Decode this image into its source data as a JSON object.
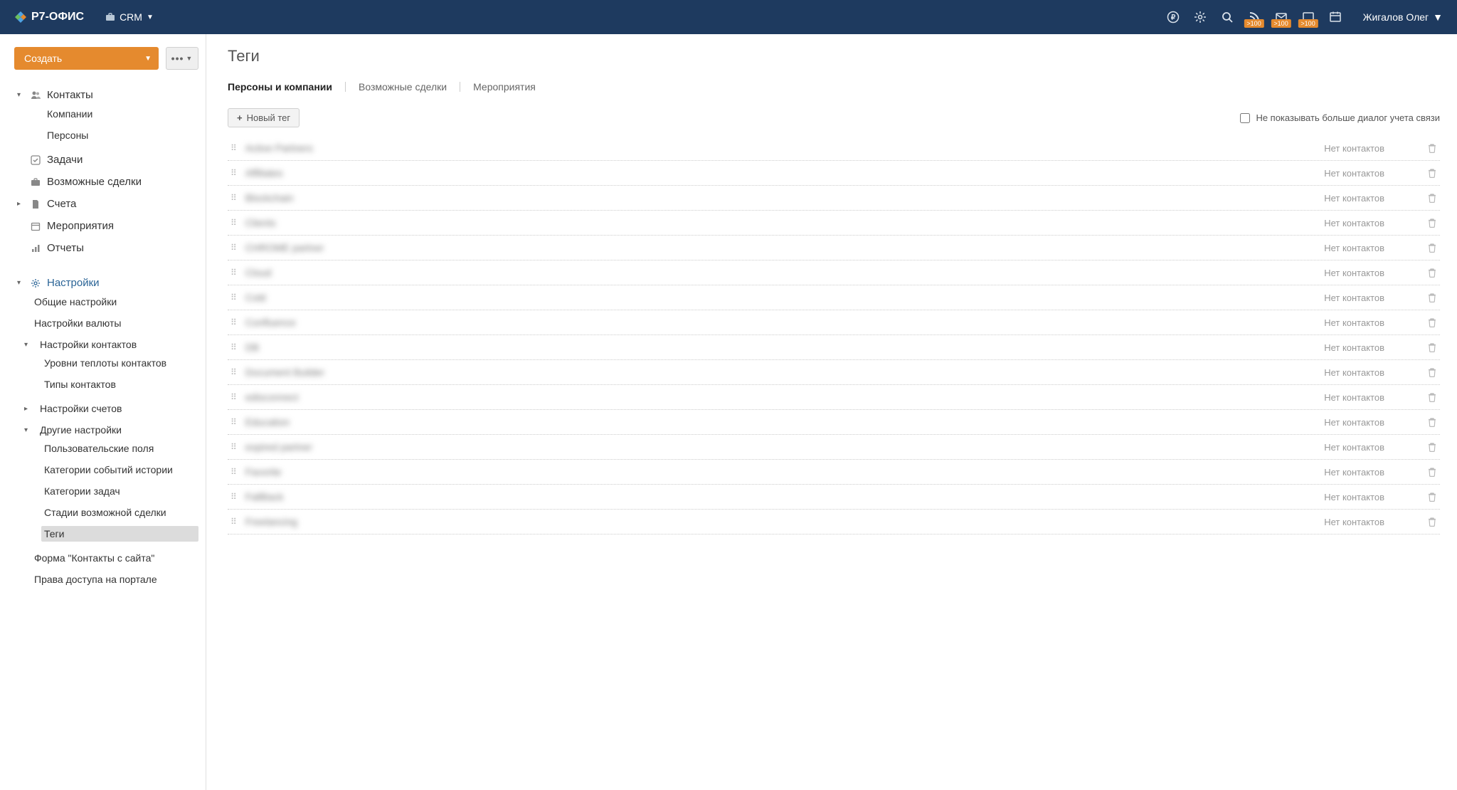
{
  "header": {
    "brand": "Р7-ОФИС",
    "module": "CRM",
    "user": "Жигалов Олег",
    "badge_value": ">100"
  },
  "sidebar": {
    "create_label": "Создать",
    "nav": {
      "contacts": "Контакты",
      "companies": "Компании",
      "persons": "Персоны",
      "tasks": "Задачи",
      "deals": "Возможные сделки",
      "invoices": "Счета",
      "events": "Мероприятия",
      "reports": "Отчеты",
      "settings": "Настройки",
      "general": "Общие настройки",
      "currency": "Настройки валюты",
      "contacts_settings": "Настройки контактов",
      "warmth": "Уровни теплоты контактов",
      "types": "Типы контактов",
      "invoice_settings": "Настройки счетов",
      "other": "Другие настройки",
      "custom_fields": "Пользовательские поля",
      "history_cats": "Категории событий истории",
      "task_cats": "Категории задач",
      "deal_stages": "Стадии возможной сделки",
      "tags": "Теги",
      "form": "Форма \"Контакты с сайта\"",
      "access": "Права доступа на портале"
    }
  },
  "content": {
    "title": "Теги",
    "tabs": {
      "persons_companies": "Персоны и компании",
      "deals": "Возможные сделки",
      "events": "Мероприятия"
    },
    "new_tag_label": "Новый тег",
    "hide_dialog_label": "Не показывать больше диалог учета связи",
    "no_contacts": "Нет контактов",
    "tags": [
      {
        "name": "Active Partners"
      },
      {
        "name": "Affiliates"
      },
      {
        "name": "Blockchain"
      },
      {
        "name": "Clients"
      },
      {
        "name": "CHROME partner"
      },
      {
        "name": "Cloud"
      },
      {
        "name": "Cold"
      },
      {
        "name": "Confluence"
      },
      {
        "name": "DB"
      },
      {
        "name": "Document Builder"
      },
      {
        "name": "edisconnect"
      },
      {
        "name": "Education"
      },
      {
        "name": "expired partner"
      },
      {
        "name": "Favorite"
      },
      {
        "name": "FallBack"
      },
      {
        "name": "Freelancing"
      }
    ]
  }
}
